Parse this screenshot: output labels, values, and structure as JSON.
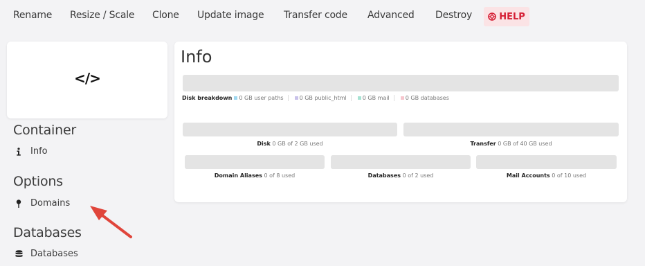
{
  "topnav": {
    "items": [
      "Rename",
      "Resize / Scale",
      "Clone",
      "Update image",
      "Transfer code",
      "Advanced",
      "Destroy"
    ],
    "help_label": "HELP",
    "help_icon": "lifebuoy-icon"
  },
  "sidebar": {
    "logo": "</>",
    "sections": [
      {
        "title": "Container",
        "items": [
          {
            "label": "Info",
            "icon": "info-icon"
          }
        ]
      },
      {
        "title": "Options",
        "items": [
          {
            "label": "Domains",
            "icon": "pin-icon"
          }
        ]
      },
      {
        "title": "Databases",
        "items": [
          {
            "label": "Databases",
            "icon": "database-icon"
          }
        ]
      }
    ]
  },
  "main": {
    "title": "Info",
    "disk_breakdown": {
      "label": "Disk breakdown",
      "items": [
        {
          "text": "0 GB user paths",
          "color": "#9fd8f0"
        },
        {
          "text": "0 GB public_html",
          "color": "#c9c2ea"
        },
        {
          "text": "0 GB mail",
          "color": "#a7e3d3"
        },
        {
          "text": "0 GB databases",
          "color": "#f6c6cd"
        }
      ]
    },
    "disk": {
      "label": "Disk",
      "value": "0 GB of 2 GB used"
    },
    "transfer": {
      "label": "Transfer",
      "value": "0 GB of 40 GB used"
    },
    "domain_aliases": {
      "label": "Domain Aliases",
      "value": "0 of 8 used"
    },
    "databases": {
      "label": "Databases",
      "value": "0 of 2 used"
    },
    "mail_accounts": {
      "label": "Mail Accounts",
      "value": "0 of 10 used"
    }
  },
  "colors": {
    "help_bg": "#fbe3e5",
    "help_text": "#d51f35",
    "arrow": "#e0453b",
    "bar": "#e4e4e4"
  }
}
